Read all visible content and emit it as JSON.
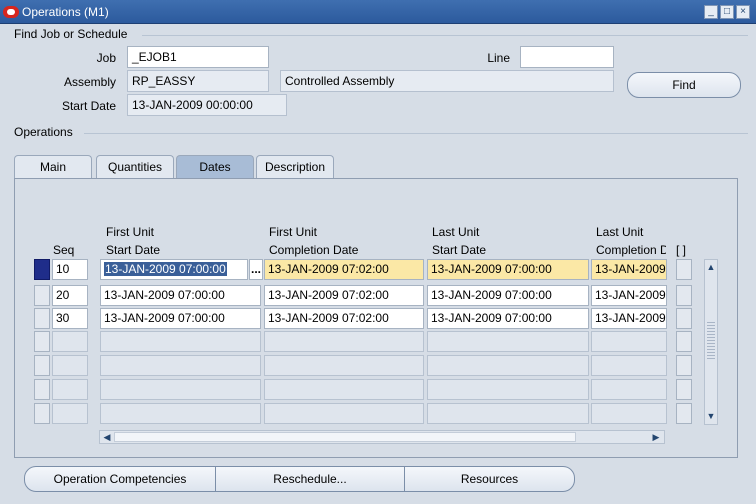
{
  "window": {
    "title": "Operations (M1)",
    "min_icon": "_",
    "max_icon": "□",
    "close_icon": "×"
  },
  "find_section": {
    "header": "Find Job or Schedule",
    "job_label": "Job",
    "job_value": "_EJOB1",
    "line_label": "Line",
    "line_value": "",
    "assembly_label": "Assembly",
    "assembly_value": "RP_EASSY",
    "assembly_desc": "Controlled Assembly",
    "start_date_label": "Start Date",
    "start_date_value": "13-JAN-2009 00:00:00",
    "find_button": "Find"
  },
  "operations_section": {
    "header": "Operations"
  },
  "tabs": [
    {
      "label": "Main",
      "active": false
    },
    {
      "label": "Quantities",
      "active": false
    },
    {
      "label": "Dates",
      "active": true
    },
    {
      "label": "Description",
      "active": false
    }
  ],
  "columns": {
    "seq": "Seq",
    "first_unit_start_1": "First Unit",
    "first_unit_start_2": "Start Date",
    "first_unit_comp_1": "First Unit",
    "first_unit_comp_2": "Completion Date",
    "last_unit_start_1": "Last Unit",
    "last_unit_start_2": "Start Date",
    "last_unit_comp_1": "Last Unit",
    "last_unit_comp_2": "Completion D",
    "flex": "[ ]"
  },
  "rows": [
    {
      "seq": "10",
      "fu_start": "13-JAN-2009 07:00:00",
      "fu_comp": "13-JAN-2009 07:02:00",
      "lu_start": "13-JAN-2009 07:00:00",
      "lu_comp": "13-JAN-2009"
    },
    {
      "seq": "20",
      "fu_start": "13-JAN-2009 07:00:00",
      "fu_comp": "13-JAN-2009 07:02:00",
      "lu_start": "13-JAN-2009 07:00:00",
      "lu_comp": "13-JAN-2009"
    },
    {
      "seq": "30",
      "fu_start": "13-JAN-2009 07:00:00",
      "fu_comp": "13-JAN-2009 07:02:00",
      "lu_start": "13-JAN-2009 07:00:00",
      "lu_comp": "13-JAN-2009"
    }
  ],
  "lov_icon": "...",
  "scroll_up": "▲",
  "scroll_down": "▼",
  "scroll_left": "◀",
  "scroll_right": "▶",
  "buttons": {
    "competencies": "Operation Competencies",
    "reschedule": "Reschedule...",
    "resources": "Resources"
  },
  "colors": {
    "selected_cell": "#fbe8a6",
    "active_row": "#1f2d8a",
    "active_tab": "#a8bcd6"
  }
}
